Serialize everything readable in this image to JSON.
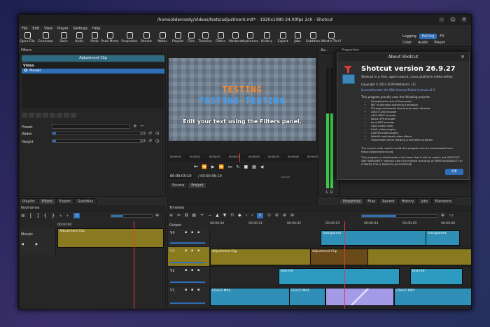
{
  "window": {
    "title": "/home/ddennedy/Videos/tests/adjustment.mlt* - 1920x1080 24.00fps 2ch - Shotcut"
  },
  "menu": [
    "File",
    "Edit",
    "View",
    "Player",
    "Settings",
    "Help"
  ],
  "toolbar": [
    "Open File",
    "Generate",
    "Save",
    "Undo",
    "Redo",
    "Peak Meter",
    "Properties",
    "Recent",
    "Notes",
    "Playlist",
    "Files",
    "Timeline",
    "Filters",
    "Markers",
    "Keyframes",
    "History",
    "Export",
    "Jobs",
    "Subtitles",
    "What's This?"
  ],
  "layouts": {
    "top": [
      "Logging",
      "Editing",
      "FX"
    ],
    "active": "Editing",
    "bottom": [
      "Color",
      "Audio",
      "Player"
    ]
  },
  "filters_panel": {
    "header": "Filters",
    "clip_name": "Adjustment Clip",
    "section": "Video",
    "filter_item": "Mosaic",
    "preset_label": "Preset",
    "width_label": "Width",
    "width_value": "1.5",
    "height_label": "Height",
    "height_value": "1.5",
    "tabs": [
      "Playlist",
      "Filters",
      "Export",
      "Subtitles"
    ],
    "active_tab": "Filters"
  },
  "audio_panel": {
    "header": "Au...",
    "channels": [
      "L",
      "R"
    ],
    "level": 0.62
  },
  "properties_header": "Properties",
  "player": {
    "overlay_title": "TESTING",
    "overlay_title2": "TESTING TESTING",
    "caption": "Edit your text using the Filters panel.",
    "ruler_ticks": [
      "00:00:00",
      "00:00:01",
      "00:00:02",
      "00:00:03",
      "00:00:04",
      "00:00:05",
      "00:00:06",
      "00:00:07"
    ],
    "timecode": "00:00:03:10",
    "duration": "/ 00:00:06:10",
    "tabs": [
      "Source",
      "Project"
    ],
    "active_tab": "Project",
    "side_labels": [
      "Playlist",
      "source"
    ],
    "playhead": 0.48
  },
  "about": {
    "title": "About Shotcut",
    "version": "Shotcut version 26.9.27",
    "desc": "Shotcut is a free, open source, cross platform video editor.",
    "copyright": "Copyright © 2011-2026 Meltytech, LLC",
    "license": "Licensed under the GNU General Public License v3.0",
    "uses": "This program proudly uses the following projects:",
    "projects": [
      "Qt application and UI framework",
      "MLT multimedia authoring framework",
      "FFmpeg multimedia format and codec libraries",
      "x264 H.264 encoder",
      "x265 HEVC encoder",
      "libvpx VP9 encoder",
      "lame MP3 encoder",
      "Opus audio codec",
      "Frei0r video plugins",
      "LADSPA audio plugins",
      "WebVfx web-based video effects",
      "Glaxnimate vector drawing & animation program"
    ],
    "source_note": "The source code used to build this program can be downloaded from https://www.shotcut.org.",
    "warranty": "This program is distributed in the hope that it will be useful, but WITHOUT ANY WARRANTY; without even the implied warranty of MERCHANTABILITY or FITNESS FOR A PARTICULAR PURPOSE.",
    "ok": "OK"
  },
  "right_tabs": [
    "Properties",
    "Files",
    "Recent",
    "History",
    "Jobs",
    "Elements"
  ],
  "keyframes": {
    "header": "Keyframes",
    "ruler": "00:00:00",
    "track_label": "Mosaic",
    "clip_label": "Adjustment Clip",
    "playhead": 0.72
  },
  "timeline": {
    "header": "Timeline",
    "output_label": "Output",
    "ruler": [
      "00:00:00",
      "00:00:01",
      "00:00:02",
      "00:00:03",
      "00:00:04",
      "00:00:05",
      "00:00:06"
    ],
    "tracks": [
      {
        "name": "V4",
        "clips": [
          {
            "label": "transparent",
            "start": 0.42,
            "end": 0.95,
            "color": "#2f8fb6"
          },
          {
            "label": "transparent",
            "start": 0.82,
            "end": 0.95,
            "color": "#2f8fb6"
          }
        ]
      },
      {
        "name": "V3",
        "clips": [
          {
            "label": "Adjustment Clip",
            "start": 0.0,
            "end": 1.0,
            "color": "#8a7a1f"
          },
          {
            "label": "Adjustment Clip",
            "start": 0.38,
            "end": 0.6,
            "color": "#6a4a18"
          }
        ]
      },
      {
        "name": "V2",
        "clips": [
          {
            "label": "text.mlt",
            "start": 0.26,
            "end": 0.72,
            "color": "#2f9ac0"
          },
          {
            "label": "text.mlt",
            "start": 0.76,
            "end": 0.96,
            "color": "#2f9ac0"
          }
        ]
      },
      {
        "name": "V1",
        "clips": [
          {
            "label": "CD437.MP4",
            "start": 0.0,
            "end": 0.44,
            "color": "#2f8fb6"
          },
          {
            "label": "CD437.MP4",
            "start": 0.3,
            "end": 0.44,
            "color": "#2f8fb6"
          },
          {
            "label": "",
            "start": 0.44,
            "end": 0.7,
            "color": "#a59ae8"
          },
          {
            "label": "CD437.MP4",
            "start": 0.7,
            "end": 1.0,
            "color": "#2f8fb6"
          }
        ]
      }
    ],
    "playhead": 0.51
  }
}
